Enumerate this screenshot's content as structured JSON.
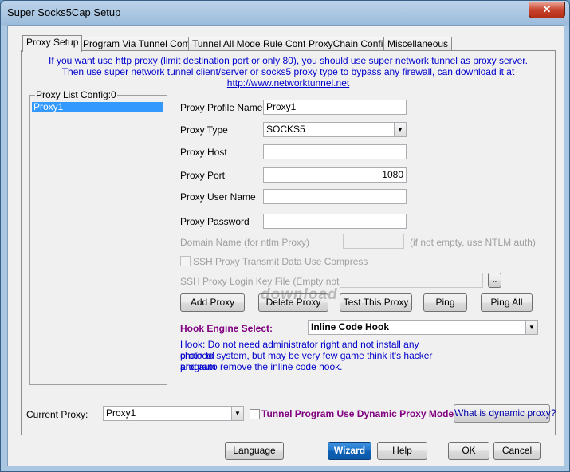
{
  "window": {
    "title": "Super Socks5Cap Setup",
    "close_label": "✕"
  },
  "tabs": [
    {
      "label": "Proxy Setup"
    },
    {
      "label": "Program Via Tunnel Config"
    },
    {
      "label": "Tunnel All Mode Rule Config"
    },
    {
      "label": "ProxyChain Config"
    },
    {
      "label": "Miscellaneous"
    }
  ],
  "notice": {
    "line1": "If you want use http proxy (limit destination port or only 80), you should use super network tunnel as proxy server.",
    "line2": "Then use super network tunnel client/server or socks5 proxy type to bypass any firewall, can download it at",
    "link": "http://www.networktunnel.net"
  },
  "proxy_list": {
    "title": "Proxy List Config:0",
    "items": [
      "Proxy1"
    ]
  },
  "form": {
    "profile_name_label": "Proxy Profile Name",
    "profile_name_value": "Proxy1",
    "type_label": "Proxy Type",
    "type_value": "SOCKS5",
    "host_label": "Proxy Host",
    "host_value": "",
    "port_label": "Proxy Port",
    "port_value": "1080",
    "user_label": "Proxy User Name",
    "user_value": "",
    "password_label": "Proxy Password",
    "password_value": "",
    "domain_label": "Domain Name (for ntlm Proxy)",
    "domain_value": "",
    "domain_note": "(if not empty, use NTLM auth)",
    "ssh_compress_label": "SSH Proxy Transmit Data Use Compress",
    "ssh_key_label": "SSH Proxy Login Key File (Empty not use)",
    "ssh_key_value": "",
    "browse_label": ".."
  },
  "buttons": {
    "add": "Add  Proxy",
    "delete": "Delete Proxy",
    "test": "Test This Proxy",
    "ping": "Ping",
    "ping_all": "Ping All"
  },
  "hook": {
    "label": "Hook Engine Select:",
    "value": "Inline Code Hook",
    "line1": "Hook: Do not need administrator right and not install any protocol",
    "line2": "chain to system, but may be very few game think it's hacker program",
    "line3": "and auto remove the inline code hook."
  },
  "current": {
    "label": "Current Proxy:",
    "value": "Proxy1",
    "dynamic_label": "Tunnel Program Use Dynamic Proxy Mode",
    "what_button": "What is dynamic proxy?"
  },
  "footer": {
    "language": "Language",
    "wizard": "Wizard",
    "help": "Help",
    "ok": "OK",
    "cancel": "Cancel"
  },
  "watermark": "download"
}
